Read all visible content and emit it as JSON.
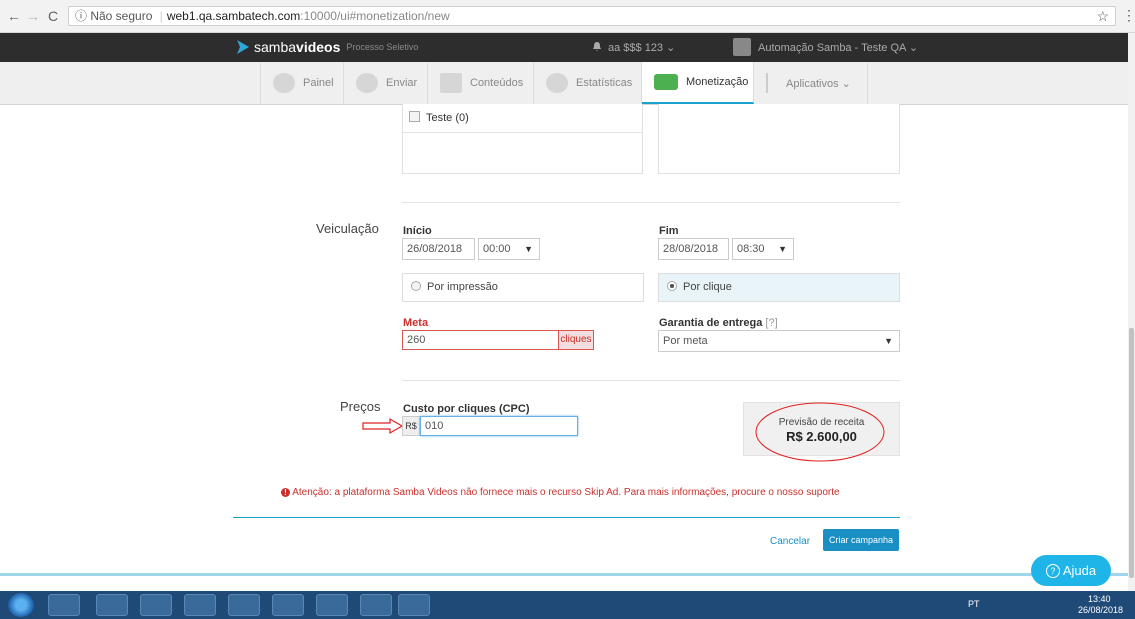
{
  "browser": {
    "back": "←",
    "forward": "→",
    "reload": "C",
    "security": "ⓘ Não seguro",
    "url_host": "web1.qa.sambatech.com",
    "url_path": ":10000/ui#monetization/new",
    "star": "☆",
    "menu": "⋮"
  },
  "header": {
    "logo_text_light": "samba",
    "logo_text_bold": "videos",
    "logo_sub": "Processo Seletivo",
    "account": "aa $$$ 123 ⌄",
    "user": "Automação Samba - Teste QA ⌄"
  },
  "nav": {
    "items": [
      {
        "label": "Painel"
      },
      {
        "label": "Enviar"
      },
      {
        "label": "Conteúdos"
      },
      {
        "label": "Estatísticas"
      },
      {
        "label": "Monetização"
      },
      {
        "label": "Aplicativos ⌄"
      }
    ]
  },
  "segment": {
    "checkbox_label": "Teste (0)"
  },
  "veiculacao": {
    "section": "Veiculação",
    "inicio_label": "Início",
    "inicio_date": "26/08/2018",
    "inicio_time": "00:00",
    "fim_label": "Fim",
    "fim_date": "28/08/2018",
    "fim_time": "08:30",
    "por_impressao": "Por impressão",
    "por_clique": "Por clique",
    "meta_label": "Meta",
    "meta_value": "260",
    "meta_unit": "cliques",
    "garantia_label": "Garantia de entrega",
    "garantia_help": "[?]",
    "garantia_value": "Por meta"
  },
  "precos": {
    "section": "Preços",
    "cpc_label": "Custo por cliques (CPC)",
    "currency": "R$",
    "cpc_value": "010",
    "previsao_label": "Previsão de receita",
    "previsao_value": "R$ 2.600,00"
  },
  "warning": "Atenção: a plataforma Samba Videos não fornece mais o recurso Skip Ad. Para mais informações, procure o nosso suporte",
  "actions": {
    "cancel": "Cancelar",
    "create": "Criar campanha"
  },
  "help": {
    "label": "Ajuda"
  },
  "taskbar": {
    "lang": "PT",
    "time": "13:40",
    "date": "26/08/2018"
  },
  "colors": {
    "accent": "#1aa1cc",
    "error": "#c9302c",
    "annotation": "#e02020",
    "dark_header": "#2d2d2d"
  }
}
